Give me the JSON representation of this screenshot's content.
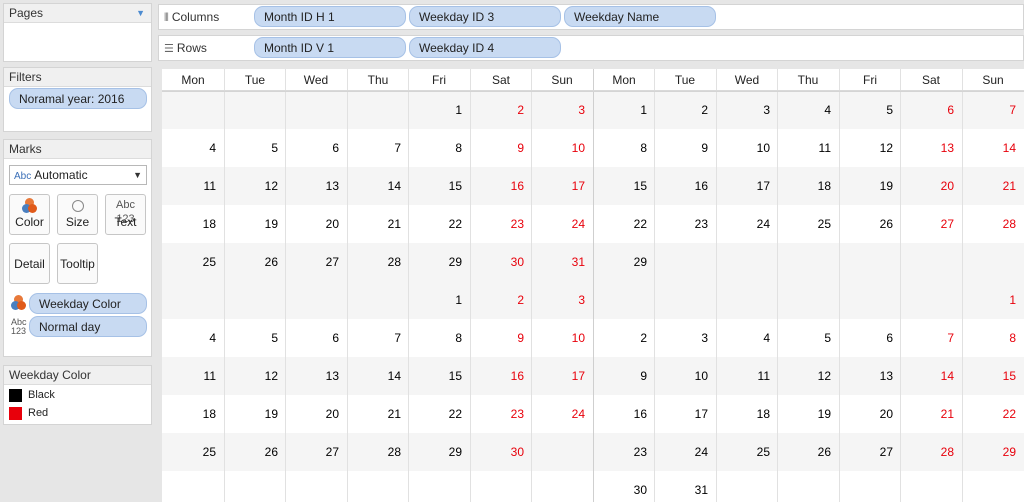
{
  "pages": {
    "title": "Pages"
  },
  "filters": {
    "title": "Filters",
    "items": [
      "Noramal year: 2016"
    ]
  },
  "marks": {
    "title": "Marks",
    "type": "Automatic",
    "type_prefix": "Abc",
    "buttons": {
      "color": "Color",
      "size": "Size",
      "text": "Text",
      "detail": "Detail",
      "tooltip": "Tooltip"
    },
    "text_icon": "Abc\n123",
    "fields": [
      {
        "icon": "color-icon",
        "label": "Weekday Color"
      },
      {
        "icon": "text-icon",
        "label": "Normal day"
      }
    ]
  },
  "legend": {
    "title": "Weekday Color",
    "items": [
      {
        "label": "Black",
        "color": "#000000"
      },
      {
        "label": "Red",
        "color": "#e8000b"
      }
    ]
  },
  "columns_shelf": {
    "label": "Columns",
    "pills": [
      "Month ID H 1",
      "Weekday ID 3",
      "Weekday Name"
    ]
  },
  "rows_shelf": {
    "label": "Rows",
    "pills": [
      "Month ID V 1",
      "Weekday ID 4"
    ]
  },
  "calendar": {
    "headers": [
      "Mon",
      "Tue",
      "Wed",
      "Thu",
      "Fri",
      "Sat",
      "Sun",
      "Mon",
      "Tue",
      "Wed",
      "Thu",
      "Fri",
      "Sat",
      "Sun"
    ],
    "colors": {
      "weekday": "#000000",
      "weekend": "#e8000b"
    },
    "blocks": [
      {
        "left": [
          [
            "",
            "",
            "",
            "",
            1,
            2,
            3
          ],
          [
            4,
            5,
            6,
            7,
            8,
            9,
            10
          ],
          [
            11,
            12,
            13,
            14,
            15,
            16,
            17
          ],
          [
            18,
            19,
            20,
            21,
            22,
            23,
            24
          ],
          [
            25,
            26,
            27,
            28,
            29,
            30,
            31
          ]
        ],
        "right": [
          [
            1,
            2,
            3,
            4,
            5,
            6,
            7
          ],
          [
            8,
            9,
            10,
            11,
            12,
            13,
            14
          ],
          [
            15,
            16,
            17,
            18,
            19,
            20,
            21
          ],
          [
            22,
            23,
            24,
            25,
            26,
            27,
            28
          ],
          [
            29,
            "",
            "",
            "",
            "",
            "",
            ""
          ]
        ]
      },
      {
        "left": [
          [
            "",
            "",
            "",
            "",
            1,
            2,
            3
          ],
          [
            4,
            5,
            6,
            7,
            8,
            9,
            10
          ],
          [
            11,
            12,
            13,
            14,
            15,
            16,
            17
          ],
          [
            18,
            19,
            20,
            21,
            22,
            23,
            24
          ],
          [
            25,
            26,
            27,
            28,
            29,
            30,
            ""
          ],
          [
            "",
            "",
            "",
            "",
            "",
            "",
            ""
          ]
        ],
        "right": [
          [
            "",
            "",
            "",
            "",
            "",
            "",
            1
          ],
          [
            2,
            3,
            4,
            5,
            6,
            7,
            8
          ],
          [
            9,
            10,
            11,
            12,
            13,
            14,
            15
          ],
          [
            16,
            17,
            18,
            19,
            20,
            21,
            22
          ],
          [
            23,
            24,
            25,
            26,
            27,
            28,
            29
          ],
          [
            30,
            31,
            "",
            "",
            "",
            "",
            ""
          ]
        ]
      }
    ]
  }
}
